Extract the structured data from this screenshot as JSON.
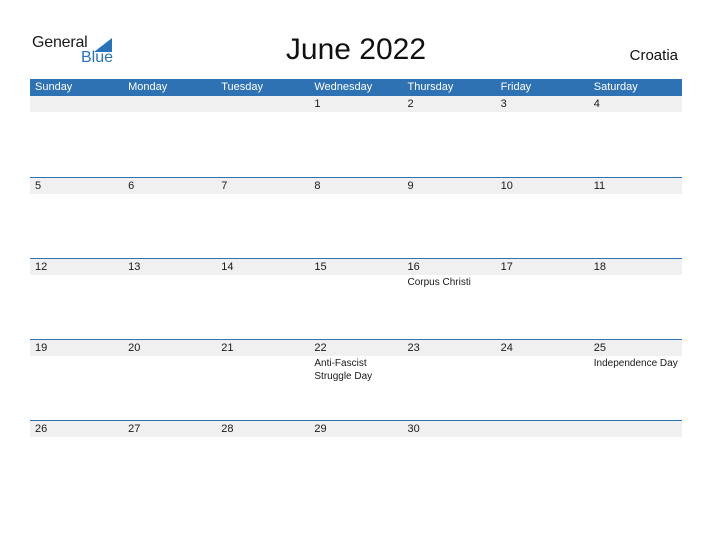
{
  "logo": {
    "general": "General",
    "blue": "Blue",
    "icon": "triangle-icon"
  },
  "header": {
    "title": "June 2022",
    "country": "Croatia"
  },
  "weekdays": [
    "Sunday",
    "Monday",
    "Tuesday",
    "Wednesday",
    "Thursday",
    "Friday",
    "Saturday"
  ],
  "weeks": [
    {
      "days": [
        "",
        "",
        "",
        "1",
        "2",
        "3",
        "4"
      ],
      "events": [
        "",
        "",
        "",
        "",
        "",
        "",
        ""
      ]
    },
    {
      "days": [
        "5",
        "6",
        "7",
        "8",
        "9",
        "10",
        "11"
      ],
      "events": [
        "",
        "",
        "",
        "",
        "",
        "",
        ""
      ]
    },
    {
      "days": [
        "12",
        "13",
        "14",
        "15",
        "16",
        "17",
        "18"
      ],
      "events": [
        "",
        "",
        "",
        "",
        "Corpus Christi",
        "",
        ""
      ]
    },
    {
      "days": [
        "19",
        "20",
        "21",
        "22",
        "23",
        "24",
        "25"
      ],
      "events": [
        "",
        "",
        "",
        "Anti-Fascist Struggle Day",
        "",
        "",
        "Independence Day"
      ]
    },
    {
      "days": [
        "26",
        "27",
        "28",
        "29",
        "30",
        "",
        ""
      ],
      "events": [
        "",
        "",
        "",
        "",
        "",
        "",
        ""
      ]
    }
  ],
  "colors": {
    "accent": "#2e72b4",
    "strip": "#f0f0f0",
    "logo_blue": "#2a73b8"
  }
}
